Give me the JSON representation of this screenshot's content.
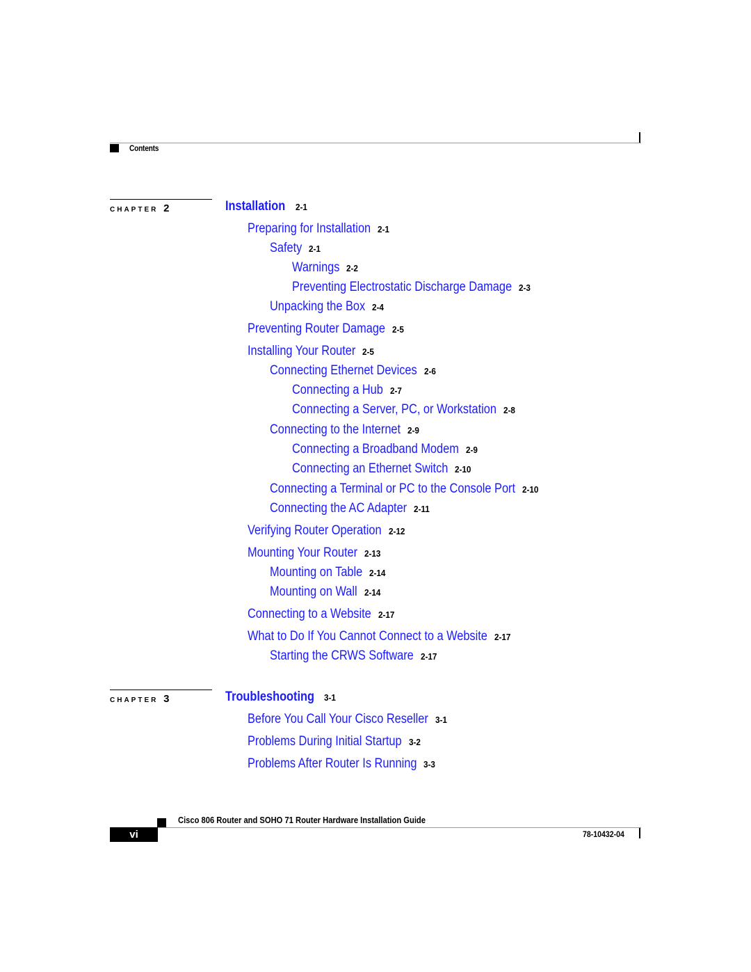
{
  "header": {
    "section_label": "Contents"
  },
  "chapters": [
    {
      "label": "CHAPTER",
      "number": "2",
      "title": "Installation",
      "page": "2-1",
      "entries": [
        {
          "level": 1,
          "title": "Preparing for Installation",
          "page": "2-1"
        },
        {
          "level": 2,
          "title": "Safety",
          "page": "2-1"
        },
        {
          "level": 3,
          "title": "Warnings",
          "page": "2-2"
        },
        {
          "level": 3,
          "title": "Preventing Electrostatic Discharge Damage",
          "page": "2-3"
        },
        {
          "level": 2,
          "title": "Unpacking the Box",
          "page": "2-4"
        },
        {
          "level": 1,
          "title": "Preventing Router Damage",
          "page": "2-5"
        },
        {
          "level": 1,
          "title": "Installing Your Router",
          "page": "2-5"
        },
        {
          "level": 2,
          "title": "Connecting Ethernet Devices",
          "page": "2-6"
        },
        {
          "level": 3,
          "title": "Connecting a Hub",
          "page": "2-7"
        },
        {
          "level": 3,
          "title": "Connecting a Server, PC, or Workstation",
          "page": "2-8"
        },
        {
          "level": 2,
          "title": "Connecting to the Internet",
          "page": "2-9"
        },
        {
          "level": 3,
          "title": "Connecting a Broadband Modem",
          "page": "2-9"
        },
        {
          "level": 3,
          "title": "Connecting an Ethernet Switch",
          "page": "2-10"
        },
        {
          "level": 2,
          "title": "Connecting a Terminal or PC to the Console Port",
          "page": "2-10"
        },
        {
          "level": 2,
          "title": "Connecting the AC Adapter",
          "page": "2-11"
        },
        {
          "level": 1,
          "title": "Verifying Router Operation",
          "page": "2-12"
        },
        {
          "level": 1,
          "title": "Mounting Your Router",
          "page": "2-13"
        },
        {
          "level": 2,
          "title": "Mounting on Table",
          "page": "2-14"
        },
        {
          "level": 2,
          "title": "Mounting on Wall",
          "page": "2-14"
        },
        {
          "level": 1,
          "title": "Connecting to a Website",
          "page": "2-17"
        },
        {
          "level": 1,
          "title": "What to Do If You Cannot Connect to a Website",
          "page": "2-17"
        },
        {
          "level": 2,
          "title": "Starting the CRWS Software",
          "page": "2-17"
        }
      ]
    },
    {
      "label": "CHAPTER",
      "number": "3",
      "title": "Troubleshooting",
      "page": "3-1",
      "entries": [
        {
          "level": 1,
          "title": "Before You Call Your Cisco Reseller",
          "page": "3-1"
        },
        {
          "level": 1,
          "title": "Problems During Initial Startup",
          "page": "3-2"
        },
        {
          "level": 1,
          "title": "Problems After Router Is Running",
          "page": "3-3"
        }
      ]
    }
  ],
  "footer": {
    "book_title": "Cisco 806 Router and SOHO 71 Router Hardware Installation Guide",
    "page_number": "vi",
    "doc_number": "78-10432-04"
  },
  "colors": {
    "link": "#1a1aff",
    "text": "#000000",
    "rule": "#9a9a9a"
  }
}
